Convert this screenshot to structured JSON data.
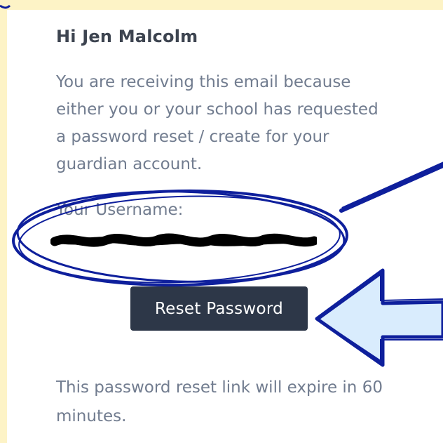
{
  "email": {
    "greeting": "Hi Jen Malcolm",
    "intro": "You are receiving this email because either you or your school has requested a password reset / create for your guardian account.",
    "username_label": "Your Username:",
    "username_value": "",
    "reset_button_label": "Reset Password",
    "expiry_text": "This password reset link will expire in 60 minutes."
  },
  "colors": {
    "page_background": "#fdf3c6",
    "card_background": "#ffffff",
    "heading_text": "#3d4450",
    "body_text": "#717c8f",
    "button_background": "#2d3748",
    "button_text": "#ffffff",
    "annotation_ink": "#0e1f9c",
    "arrow_fill": "#d9ecfd",
    "redaction": "#000000"
  },
  "annotations": {
    "circle_icon": "hand-drawn-ellipse",
    "arrow_icon": "hand-drawn-left-arrow",
    "pointer_line_icon": "hand-drawn-line"
  }
}
